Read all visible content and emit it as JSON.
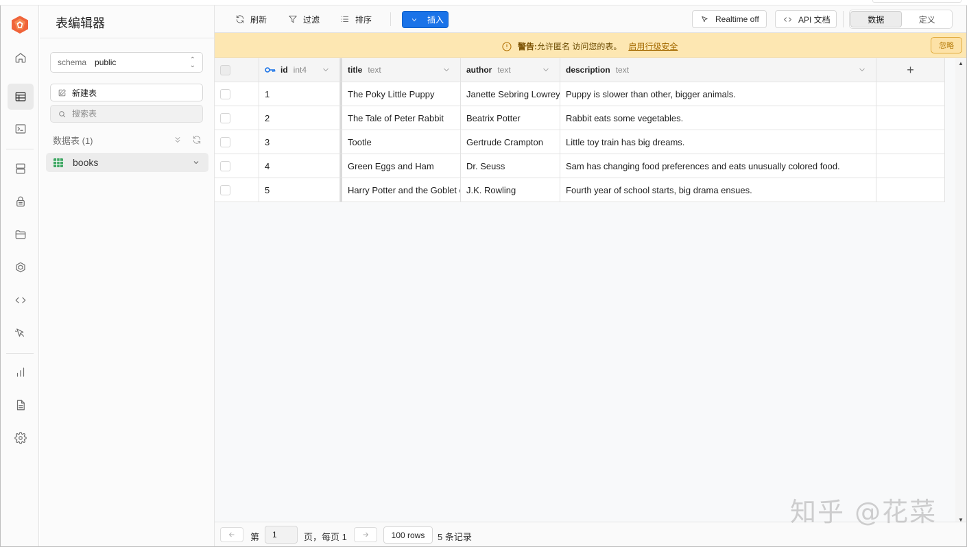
{
  "sidebar": {
    "title": "表编辑器",
    "schema_label": "schema",
    "schema_value": "public",
    "new_table": "新建表",
    "search_placeholder": "搜索表",
    "section_title": "数据表 (1)",
    "tables": [
      {
        "name": "books"
      }
    ]
  },
  "toolbar": {
    "refresh": "刷新",
    "filter": "过滤",
    "sort": "排序",
    "insert": "插入",
    "realtime": "Realtime off",
    "api_docs": "API 文档",
    "tab_data": "数据",
    "tab_definition": "定义"
  },
  "warning": {
    "label": "警告:",
    "text": "允许匿名 访问您的表。",
    "link": "启用行级安全",
    "ignore": "忽略",
    "color": "#fde7b2"
  },
  "grid": {
    "columns": [
      {
        "name": "id",
        "type": "int4"
      },
      {
        "name": "title",
        "type": "text"
      },
      {
        "name": "author",
        "type": "text"
      },
      {
        "name": "description",
        "type": "text"
      }
    ],
    "rows": [
      {
        "id": "1",
        "title": "The Poky Little Puppy",
        "author": "Janette Sebring Lowrey",
        "description": "Puppy is slower than other, bigger animals."
      },
      {
        "id": "2",
        "title": "The Tale of Peter Rabbit",
        "author": "Beatrix Potter",
        "description": "Rabbit eats some vegetables."
      },
      {
        "id": "3",
        "title": "Tootle",
        "author": "Gertrude Crampton",
        "description": "Little toy train has big dreams."
      },
      {
        "id": "4",
        "title": "Green Eggs and Ham",
        "author": "Dr. Seuss",
        "description": "Sam has changing food preferences and eats unusually colored food."
      },
      {
        "id": "5",
        "title": "Harry Potter and the Goblet of Fire",
        "author": "J.K. Rowling",
        "description": "Fourth year of school starts, big drama ensues."
      }
    ]
  },
  "footer": {
    "page_prefix": "第",
    "page_value": "1",
    "page_suffix": "页，每页 1",
    "rows_per_page": "100 rows",
    "record_count": "5 条记录"
  },
  "watermark": "知乎 @花菜",
  "colors": {
    "accent": "#1a73e8",
    "brand": "#f0643a"
  }
}
